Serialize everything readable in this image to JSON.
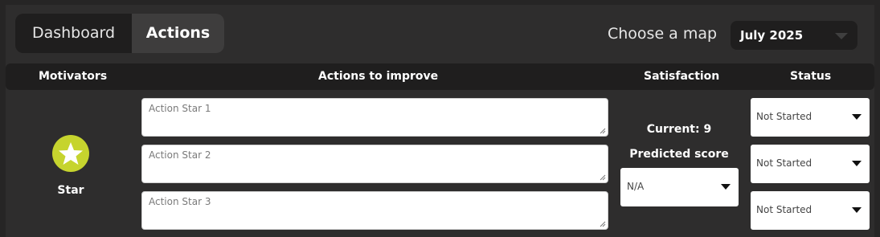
{
  "tabs": {
    "dashboard": "Dashboard",
    "actions": "Actions",
    "active": "Actions"
  },
  "map": {
    "label": "Choose a map",
    "selected": "July 2025"
  },
  "headers": {
    "motivators": "Motivators",
    "actions": "Actions to improve",
    "satisfaction": "Satisfaction",
    "status": "Status"
  },
  "motivator": {
    "name": "Star",
    "icon": "star-icon",
    "color": "#c6d42e"
  },
  "actions": [
    {
      "placeholder": "Action Star 1",
      "value": ""
    },
    {
      "placeholder": "Action Star 2",
      "value": ""
    },
    {
      "placeholder": "Action Star 3",
      "value": ""
    }
  ],
  "satisfaction": {
    "current": "Current: 9",
    "predicted_label": "Predicted score",
    "predicted_value": "N/A"
  },
  "statuses": [
    "Not Started",
    "Not Started",
    "Not Started"
  ]
}
